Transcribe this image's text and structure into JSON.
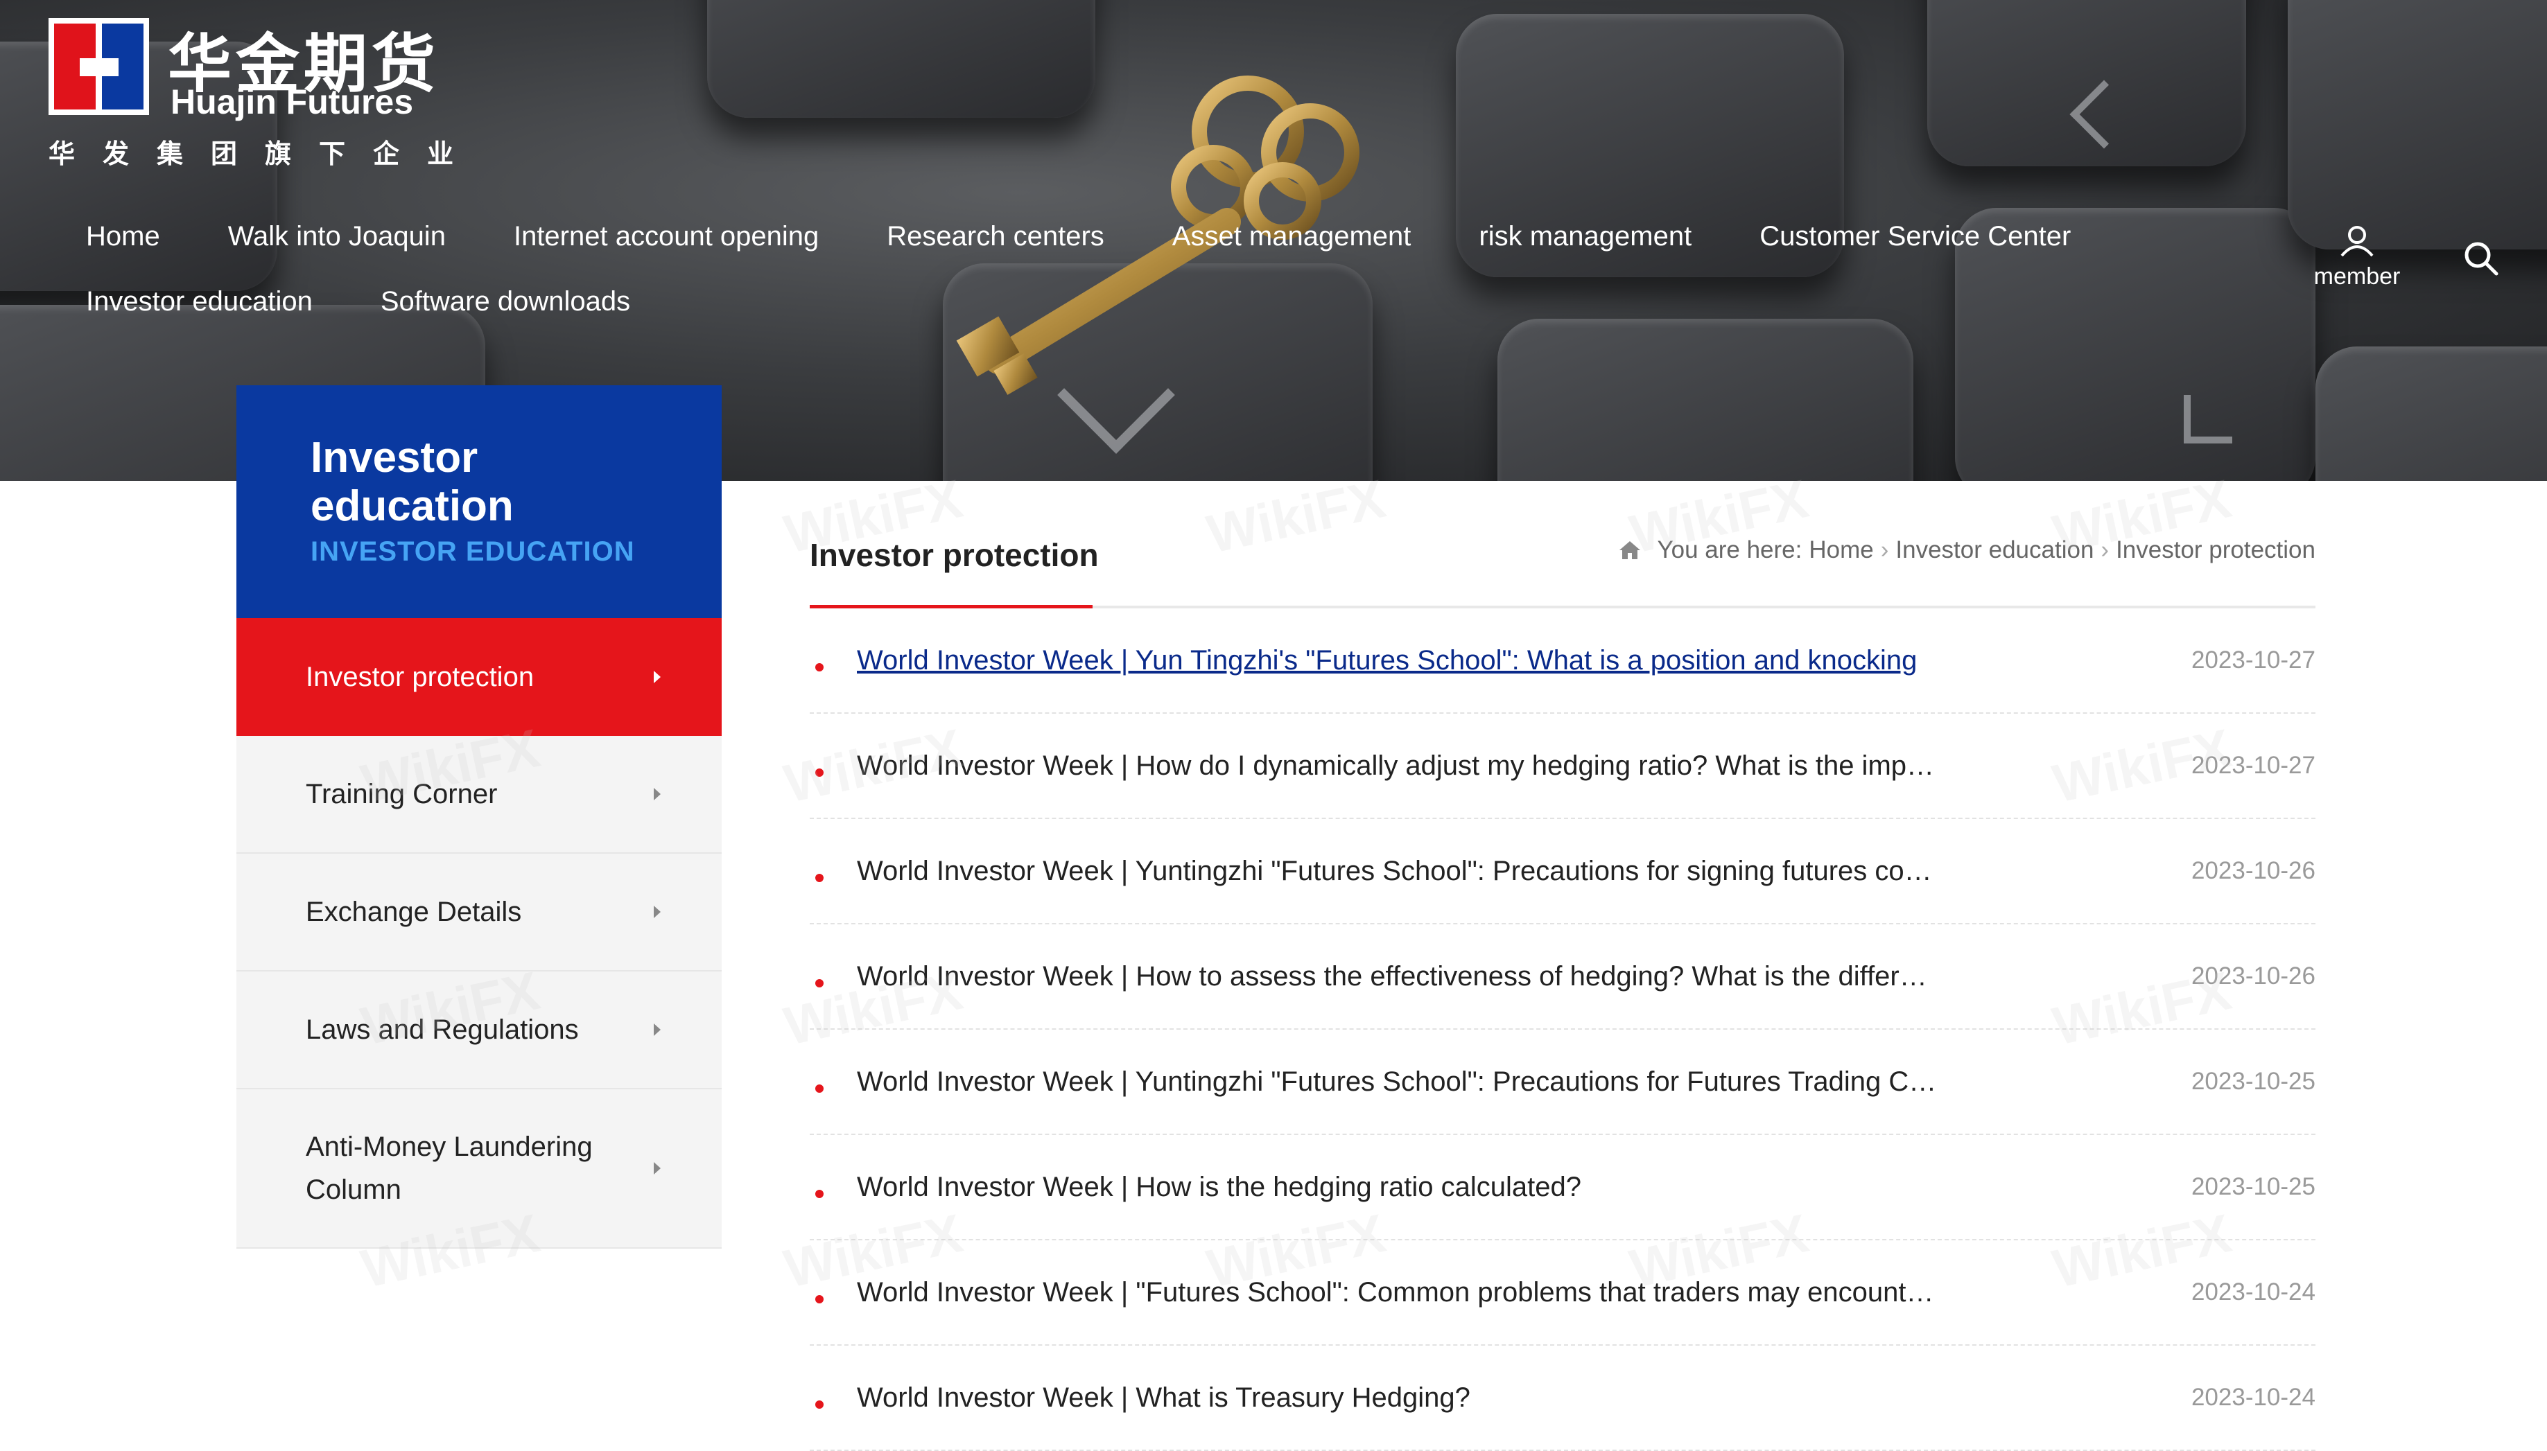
{
  "brand": {
    "name_cn": "华金期货",
    "name_en": "Huajin Futures",
    "tagline_cn": "华发集团旗下企业",
    "colors": {
      "red": "#e0131b",
      "blue": "#0a39a0"
    }
  },
  "nav": {
    "row1": [
      "Home",
      "Walk into Joaquin",
      "Internet account opening",
      "Research centers",
      "Asset management",
      "risk management",
      "Customer Service Center"
    ],
    "row2": [
      "Investor education",
      "Software downloads"
    ],
    "member_label": "member",
    "icons": {
      "member": "user-icon",
      "search": "search-icon"
    }
  },
  "sidebar": {
    "title": "Investor education",
    "subtitle": "INVESTOR EDUCATION",
    "items": [
      {
        "label": "Investor protection",
        "active": true
      },
      {
        "label": "Training Corner",
        "active": false
      },
      {
        "label": "Exchange Details",
        "active": false
      },
      {
        "label": "Laws and Regulations",
        "active": false
      },
      {
        "label": "Anti-Money Laundering Column",
        "active": false
      }
    ]
  },
  "main": {
    "title": "Investor protection",
    "breadcrumb": {
      "prefix": "You are here:",
      "items": [
        "Home",
        "Investor education",
        "Investor protection"
      ]
    },
    "articles": [
      {
        "title": "World Investor Week | Yun Tingzhi's \"Futures School\": What is a position and knocking",
        "date": "2023-10-27"
      },
      {
        "title": "World Investor Week | How do I dynamically adjust my hedging ratio? What is the imp…",
        "date": "2023-10-27"
      },
      {
        "title": "World Investor Week | Yuntingzhi \"Futures School\": Precautions for signing futures co…",
        "date": "2023-10-26"
      },
      {
        "title": "World Investor Week | How to assess the effectiveness of hedging? What is the differ…",
        "date": "2023-10-26"
      },
      {
        "title": "World Investor Week | Yuntingzhi \"Futures School\": Precautions for Futures Trading C…",
        "date": "2023-10-25"
      },
      {
        "title": "World Investor Week | How is the hedging ratio calculated?",
        "date": "2023-10-25"
      },
      {
        "title": "World Investor Week | \"Futures School\": Common problems that traders may encount…",
        "date": "2023-10-24"
      },
      {
        "title": "World Investor Week | What is Treasury Hedging?",
        "date": "2023-10-24"
      }
    ]
  },
  "watermark": "WikiFX",
  "accent_colors": {
    "active_red": "#e5151b",
    "sidebar_blue": "#0a39a0",
    "subtitle_blue": "#46a4f4"
  }
}
